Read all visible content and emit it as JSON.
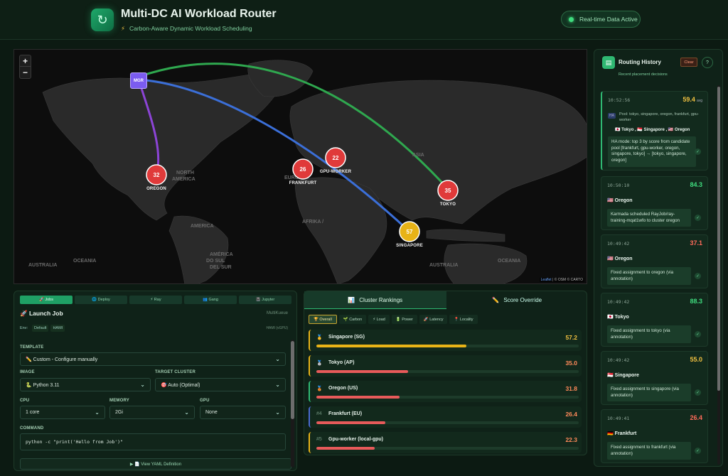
{
  "header": {
    "title": "Multi-DC AI Workload Router",
    "subtitle": "Carbon-Aware Dynamic Workload Scheduling",
    "status_badge": "Real-time Data Active"
  },
  "map": {
    "zoom_in": "+",
    "zoom_out": "−",
    "manager_label": "MGR",
    "attribution_leaflet": "Leaflet",
    "attribution_rest": "| © OSM © CARTO",
    "region_labels": [
      "NORTH",
      "AMERICA",
      "AMERICA",
      "AMÉRICA",
      "DO SUL",
      "DEL SUR",
      "AUSTRALIA",
      "OCEANIA",
      "AFRIKA /",
      "EUROPE",
      "AUSTRALIA",
      "OCEANIA",
      "ASIA"
    ],
    "clusters": [
      {
        "name": "OREGON",
        "score": "32",
        "color": "#e03a3a"
      },
      {
        "name": "FRANKFURT",
        "score": "26",
        "color": "#e03a3a"
      },
      {
        "name": "GPU-WORKER",
        "score": "22",
        "color": "#e03a3a"
      },
      {
        "name": "TOKYO",
        "score": "35",
        "color": "#e03a3a"
      },
      {
        "name": "SINGAPORE",
        "score": "57",
        "color": "#e8b317"
      }
    ]
  },
  "job": {
    "tabs": [
      "🚀 Jobs",
      "🌐 Deploy",
      "⚡ Ray",
      "👥 Gang",
      "📓 Jupyter"
    ],
    "title": "Launch Job",
    "multikueue": "MultiKueue",
    "env_label": "Env:",
    "env_value": "Default",
    "env_tag": "HAMI",
    "hami_note": "HAMI (vGPU)",
    "template_label": "TEMPLATE",
    "template_value": "✏️ Custom - Configure manually",
    "image_label": "IMAGE",
    "image_value": "🐍 Python 3.11",
    "cluster_label": "TARGET CLUSTER",
    "cluster_value": "🎯 Auto (Optimal)",
    "cpu_label": "CPU",
    "cpu_value": "1 core",
    "memory_label": "MEMORY",
    "memory_value": "2Gi",
    "gpu_label": "GPU",
    "gpu_value": "None",
    "command_label": "COMMAND",
    "command_value": "python -c \"print('Hello from Job')\"",
    "yaml_button": "▶ 📄 View YAML Definition"
  },
  "rankings": {
    "tab_rankings": "Cluster Rankings",
    "tab_override": "Score Override",
    "filters": [
      "🏆 Overall",
      "🌱 Carbon",
      "⚡ Load",
      "🔋 Power",
      "🚀 Latency",
      "📍 Locality"
    ],
    "rows": [
      {
        "rank": "🥇",
        "name": "Singapore (SG)",
        "score": "57.2",
        "pct": 57.2,
        "color": "#e8b317",
        "border": "#e8b317"
      },
      {
        "rank": "🥈",
        "name": "Tokyo (AP)",
        "score": "35.0",
        "pct": 35.0,
        "color": "#e85a5a",
        "border": "#e8b317"
      },
      {
        "rank": "🥉",
        "name": "Oregon (US)",
        "score": "31.8",
        "pct": 31.8,
        "color": "#e85a5a",
        "border": "#2fb872"
      },
      {
        "rank": "#4",
        "name": "Frankfurt (EU)",
        "score": "26.4",
        "pct": 26.4,
        "color": "#e85a5a",
        "border": "#4a6ad0"
      },
      {
        "rank": "#5",
        "name": "Gpu-worker (local-gpu)",
        "score": "22.3",
        "pct": 22.3,
        "color": "#e85a5a",
        "border": "#e8b317"
      }
    ]
  },
  "history": {
    "title": "Routing History",
    "clear": "Clear",
    "help": "?",
    "subtitle": "Recent placement decisions",
    "first": {
      "time": "10:52:56",
      "score": "59.4",
      "avg": "avg",
      "badge": "HA",
      "pool": "Pool: tokyo, singapore, oregon, frankfurt, gpu-worker",
      "flags": "🇯🇵 Tokyo , 🇸🇬 Singapore , 🇺🇸 Oregon",
      "message": "HA mode: top 3 by score from candidate pool [frankfurt, gpu-worker, oregon, singapore, tokyo] → [tokyo, singapore, oregon]"
    },
    "items": [
      {
        "time": "10:50:10",
        "score": "84.3",
        "color": "#3fdc7e",
        "dc": "🇺🇸 Oregon",
        "message": "Karmada scheduled RayJob/ray-training-mqat1wfo to cluster oregon"
      },
      {
        "time": "10:49:42",
        "score": "37.1",
        "color": "#ff6b5a",
        "dc": "🇺🇸 Oregon",
        "message": "Fixed assignment to oregon (via annotation)"
      },
      {
        "time": "10:49:42",
        "score": "88.3",
        "color": "#3fdc7e",
        "dc": "🇯🇵 Tokyo",
        "message": "Fixed assignment to tokyo (via annotation)"
      },
      {
        "time": "10:49:42",
        "score": "55.0",
        "color": "#f0c040",
        "dc": "🇸🇬 Singapore",
        "message": "Fixed assignment to singapore (via annotation)"
      },
      {
        "time": "10:49:41",
        "score": "26.4",
        "color": "#ff6b5a",
        "dc": "🇩🇪 Frankfurt",
        "message": "Fixed assignment to frankfurt (via annotation)"
      }
    ]
  }
}
